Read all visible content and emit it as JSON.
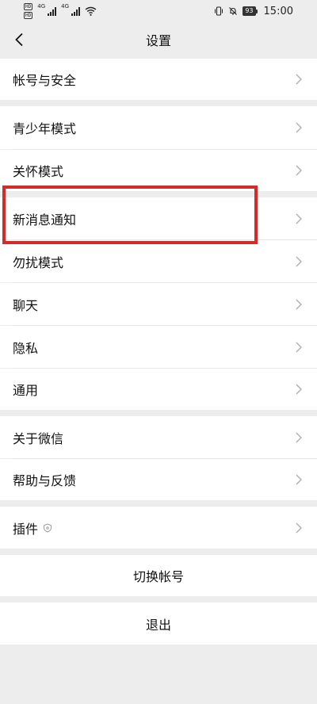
{
  "status_bar": {
    "sim1": "HD",
    "sim2": "HD",
    "net1": "4G",
    "net2": "4G",
    "battery": "93",
    "time": "15:00"
  },
  "nav": {
    "title": "设置"
  },
  "sections": {
    "account": {
      "label": "帐号与安全"
    },
    "teen_mode": {
      "label": "青少年模式"
    },
    "care_mode": {
      "label": "关怀模式"
    },
    "notifications": {
      "label": "新消息通知"
    },
    "dnd": {
      "label": "勿扰模式"
    },
    "chat": {
      "label": "聊天"
    },
    "privacy": {
      "label": "隐私"
    },
    "general": {
      "label": "通用"
    },
    "about": {
      "label": "关于微信"
    },
    "help": {
      "label": "帮助与反馈"
    },
    "plugins": {
      "label": "插件"
    },
    "switch_account": {
      "label": "切换帐号"
    },
    "logout": {
      "label": "退出"
    }
  },
  "colors": {
    "background": "#ededed",
    "row": "#ffffff",
    "highlight": "#d42a2a",
    "chevron": "#b2b2b2"
  }
}
